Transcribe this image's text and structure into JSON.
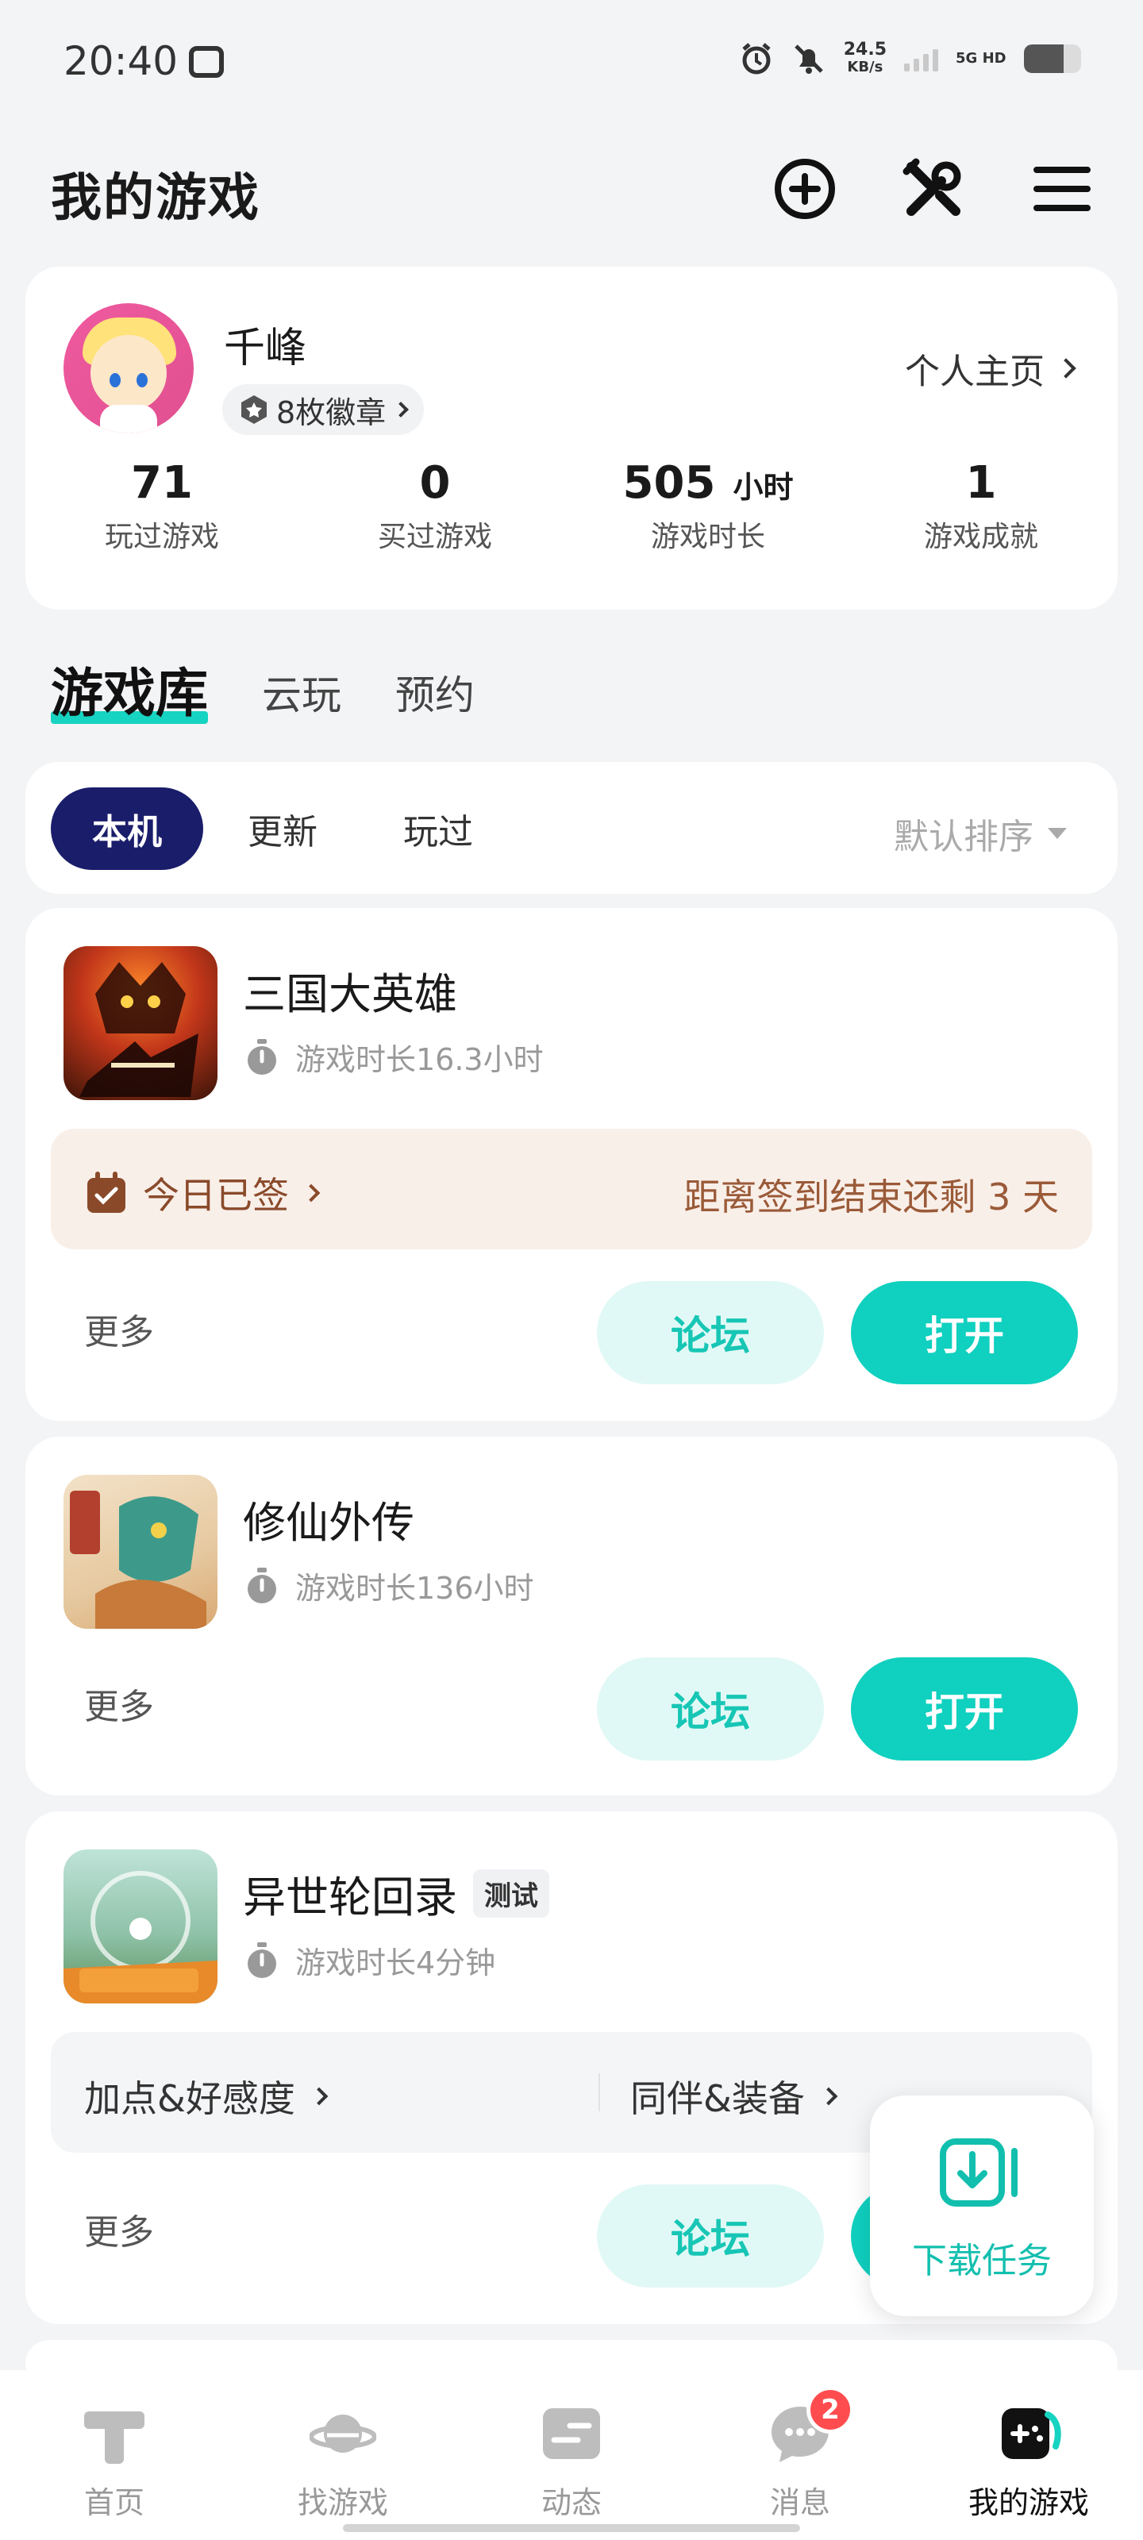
{
  "status_bar": {
    "time": "20:40",
    "net_speed_value": "24.5",
    "net_speed_unit": "KB/s",
    "network_type": "5G HD"
  },
  "header": {
    "title": "我的游戏",
    "icons": [
      "add-circle-icon",
      "tools-icon",
      "menu-icon"
    ]
  },
  "profile": {
    "name": "千峰",
    "badges_label": "8枚徽章",
    "homepage_label": "个人主页",
    "stats": [
      {
        "value": "71",
        "unit": "",
        "label": "玩过游戏"
      },
      {
        "value": "0",
        "unit": "",
        "label": "买过游戏"
      },
      {
        "value": "505",
        "unit": "小时",
        "label": "游戏时长"
      },
      {
        "value": "1",
        "unit": "",
        "label": "游戏成就"
      }
    ]
  },
  "main_tabs": [
    {
      "label": "游戏库",
      "active": true
    },
    {
      "label": "云玩",
      "active": false
    },
    {
      "label": "预约",
      "active": false
    }
  ],
  "filter": {
    "chips": [
      {
        "label": "本机",
        "active": true
      },
      {
        "label": "更新",
        "active": false
      },
      {
        "label": "玩过",
        "active": false
      }
    ],
    "sort_label": "默认排序"
  },
  "games": [
    {
      "name": "三国大英雄",
      "tag": "",
      "play_time": "游戏时长16.3小时",
      "checkin": {
        "status": "今日已签",
        "remaining": "距离签到结束还剩 3 天"
      },
      "more_label": "更多",
      "forum_label": "论坛",
      "open_label": "打开"
    },
    {
      "name": "修仙外传",
      "tag": "",
      "play_time": "游戏时长136小时",
      "more_label": "更多",
      "forum_label": "论坛",
      "open_label": "打开"
    },
    {
      "name": "异世轮回录",
      "tag": "测试",
      "play_time": "游戏时长4分钟",
      "info_links": [
        "加点&好感度",
        "同伴&装备"
      ],
      "more_label": "更多",
      "forum_label": "论坛",
      "open_label": "打开"
    }
  ],
  "download_fab": {
    "label": "下载任务"
  },
  "bottom_nav": [
    {
      "label": "首页",
      "icon": "home-icon"
    },
    {
      "label": "找游戏",
      "icon": "planet-icon"
    },
    {
      "label": "动态",
      "icon": "feed-icon"
    },
    {
      "label": "消息",
      "icon": "message-icon",
      "badge": "2"
    },
    {
      "label": "我的游戏",
      "icon": "gamepad-icon",
      "active": true
    }
  ],
  "colors": {
    "accent": "#10d0bf",
    "accent_light": "#e1f9f6",
    "chip_active": "#1a1d6a",
    "checkin_bg": "#f9efe9",
    "badge_red": "#ff4d4f"
  }
}
